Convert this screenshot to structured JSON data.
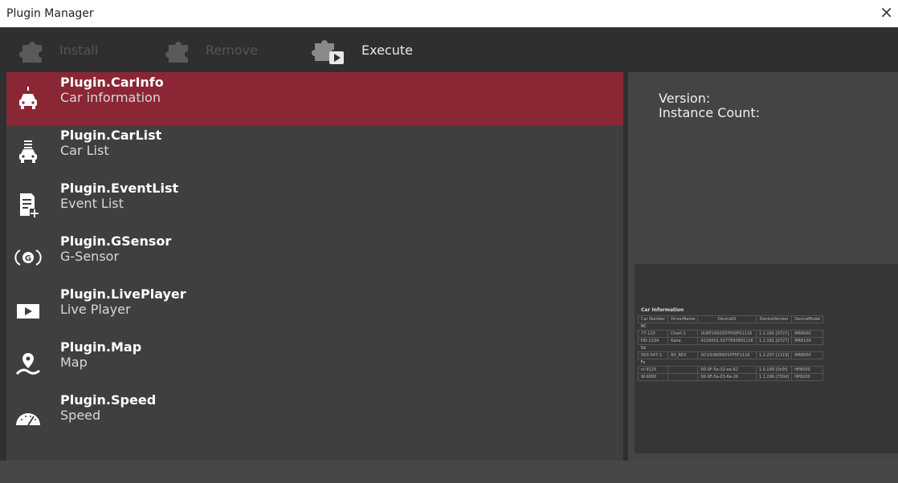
{
  "window": {
    "title": "Plugin Manager",
    "close_glyph": "×"
  },
  "toolbar": {
    "install": {
      "label": "Install",
      "icon": "puzzle-install-icon",
      "enabled": false
    },
    "remove": {
      "label": "Remove",
      "icon": "puzzle-remove-icon",
      "enabled": false
    },
    "execute": {
      "label": "Execute",
      "icon": "puzzle-execute-icon",
      "enabled": true
    }
  },
  "plugins": [
    {
      "name": "Plugin.CarInfo",
      "desc": "Car information",
      "icon": "car-info-icon",
      "selected": true
    },
    {
      "name": "Plugin.CarList",
      "desc": "Car List",
      "icon": "car-list-icon",
      "selected": false
    },
    {
      "name": "Plugin.EventList",
      "desc": "Event List",
      "icon": "event-list-icon",
      "selected": false
    },
    {
      "name": "Plugin.GSensor",
      "desc": "G-Sensor",
      "icon": "gsensor-icon",
      "selected": false
    },
    {
      "name": "Plugin.LivePlayer",
      "desc": "Live Player",
      "icon": "live-player-icon",
      "selected": false
    },
    {
      "name": "Plugin.Map",
      "desc": "Map",
      "icon": "map-pin-icon",
      "selected": false
    },
    {
      "name": "Plugin.Speed",
      "desc": "Speed",
      "icon": "speedometer-icon",
      "selected": false
    }
  ],
  "details": {
    "version_label": "Version:",
    "instance_label": "Instance Count:"
  },
  "preview": {
    "title": "Car Information",
    "headers": [
      "Car Number",
      "DriverName",
      "DeviceID",
      "DeviceVersion",
      "DeviceModel"
    ],
    "groups": [
      {
        "group": "HC",
        "rows": [
          [
            "77-123",
            "Chart-1",
            "UUPP1600307P00F01116",
            "1.2.181 [0727]",
            "MR8000"
          ],
          [
            "HD-1234",
            "Kane",
            "A156001.5077E90801116",
            "1.2.181 [0727]",
            "MR8100"
          ]
        ]
      },
      {
        "group": "Sd",
        "rows": [
          [
            "SVX-547-1",
            "BS_REX",
            "GCU5/N0RR01PP5F1116",
            "1.2.207 [1119]",
            "MR8000"
          ]
        ]
      },
      {
        "group": "Fx",
        "rows": [
          [
            "nl-9125",
            "",
            "00-0F-5e-32-ee-62",
            "1.0.199 [0c0f]",
            "HP8000"
          ],
          [
            "W-9000",
            "",
            "00-0F-5a-03-6e-26",
            "1.1.206 [730d]",
            "HP8200"
          ]
        ]
      }
    ]
  },
  "colors": {
    "selected": "#8b2635",
    "panel": "#3f3f3f",
    "toolbar": "#2f2f2f"
  }
}
